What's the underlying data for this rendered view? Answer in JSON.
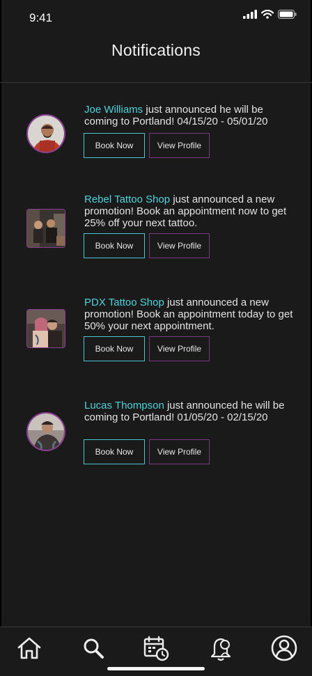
{
  "status": {
    "time": "9:41"
  },
  "header": {
    "title": "Notifications"
  },
  "notifications": [
    {
      "name": "Joe Williams",
      "text": " just announced he will be coming to Portland!  04/15/20 - 05/01/20",
      "book_label": "Book  Now",
      "view_label": "View Profile"
    },
    {
      "name": "Rebel Tattoo Shop",
      "text": " just announced a new promotion! Book an appointment now to get 25% off your next tattoo.",
      "book_label": "Book  Now",
      "view_label": "View Profile"
    },
    {
      "name": "PDX Tattoo Shop",
      "text": " just announced a new promotion! Book an appointment today to get 50% your next appointment.",
      "book_label": "Book  Now",
      "view_label": "View Profile"
    },
    {
      "name": "Lucas Thompson",
      "text": " just announced he will be coming to Portland!  01/05/20 - 02/15/20",
      "book_label": "Book  Now",
      "view_label": "View Profile"
    }
  ],
  "tabbar": {
    "icons": [
      "home-icon",
      "search-icon",
      "calendar-clock-icon",
      "bell-icon",
      "profile-icon"
    ]
  },
  "colors": {
    "background": "#1b1a1a",
    "accent_teal": "#4fd3dc",
    "accent_purple": "#7a3884"
  }
}
